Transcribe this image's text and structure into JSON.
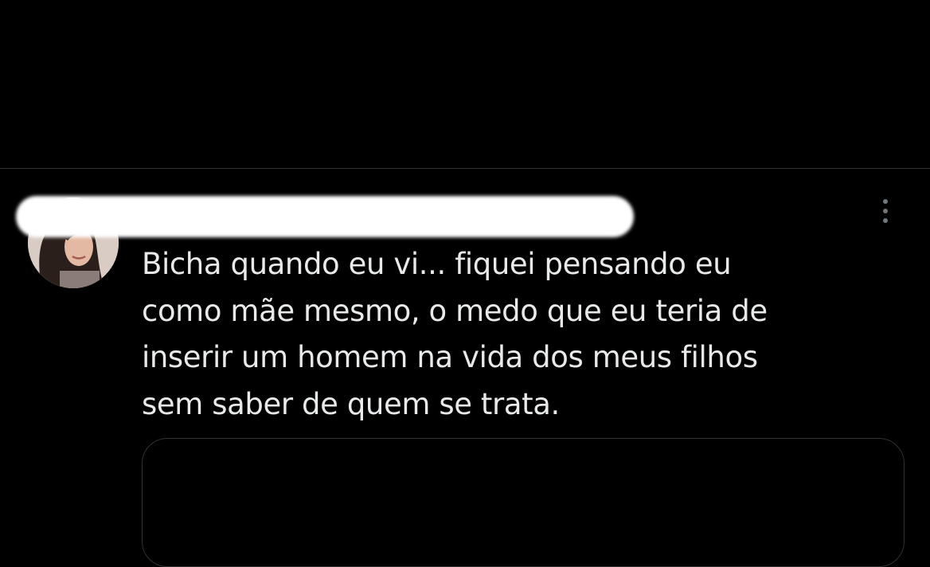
{
  "tweet": {
    "text": "Bicha quando eu vi... fiquei pensando eu\ncomo mãe mesmo, o medo que eu teria de\ninserir um homem na vida dos meus filhos\nsem saber de quem se trata.",
    "author_redacted": true,
    "more_icon": "more-vertical-icon"
  },
  "colors": {
    "background": "#000000",
    "text": "#e7e9ea",
    "divider": "#2f3336",
    "icon": "#71767b"
  }
}
